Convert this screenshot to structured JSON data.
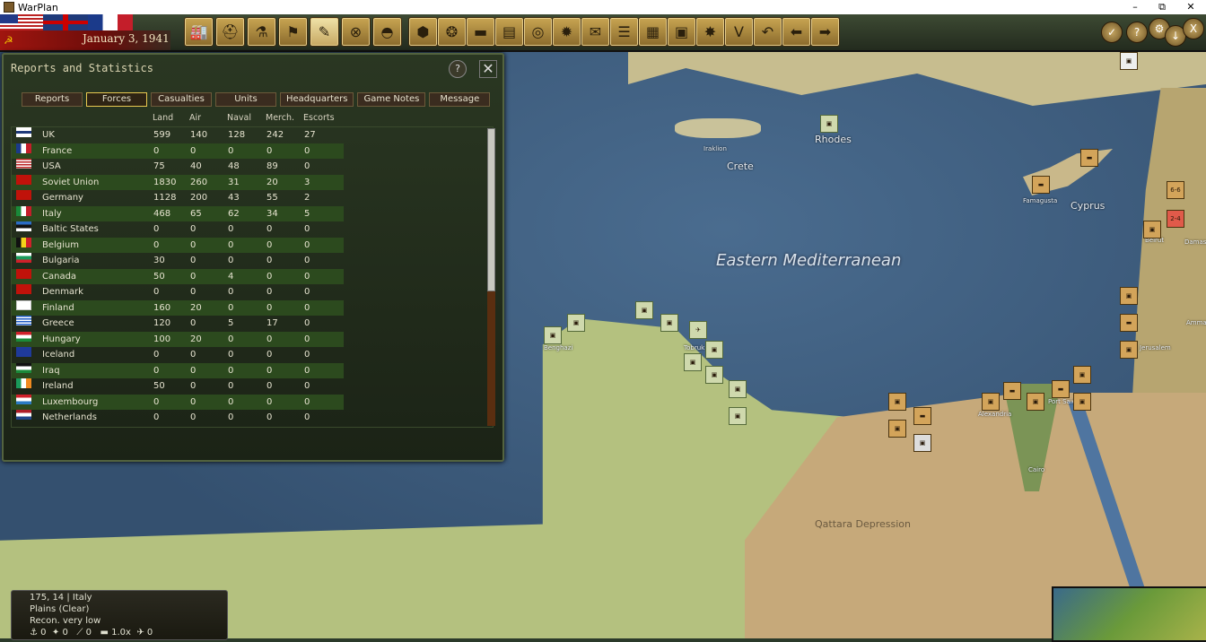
{
  "window": {
    "title": "WarPlan",
    "minimize": "–",
    "maximize": "⧉",
    "close": "✕"
  },
  "toolbar": {
    "date": "January 3, 1941",
    "buttons": [
      "production",
      "research-flask",
      "flag",
      "reports",
      "binoculars",
      "helmet",
      "hex-terrain",
      "hex-cities",
      "tank",
      "supply",
      "target",
      "sun",
      "envelope",
      "rails",
      "grid",
      "border",
      "explosion",
      "victory",
      "undo",
      "prev",
      "next"
    ],
    "right_buttons": [
      "✓",
      "?",
      "↓",
      "X"
    ]
  },
  "panel": {
    "title": "Reports and Statistics",
    "help": "?",
    "close": "✕",
    "tabs": [
      "Reports",
      "Forces",
      "Casualties",
      "Units",
      "Headquarters",
      "Game Notes",
      "Message"
    ],
    "active_tab": "Forces",
    "columns": [
      "Land",
      "Air",
      "Naval",
      "Merch.",
      "Escorts"
    ],
    "rows": [
      {
        "country": "UK",
        "land": "599",
        "air": "140",
        "naval": "128",
        "merch": "242",
        "escorts": "27",
        "flag": "uk"
      },
      {
        "country": "France",
        "land": "0",
        "air": "0",
        "naval": "0",
        "merch": "0",
        "escorts": "0",
        "flag": "fr"
      },
      {
        "country": "USA",
        "land": "75",
        "air": "40",
        "naval": "48",
        "merch": "89",
        "escorts": "0",
        "flag": "us"
      },
      {
        "country": "Soviet Union",
        "land": "1830",
        "air": "260",
        "naval": "31",
        "merch": "20",
        "escorts": "3",
        "flag": "su"
      },
      {
        "country": "Germany",
        "land": "1128",
        "air": "200",
        "naval": "43",
        "merch": "55",
        "escorts": "2",
        "flag": "de"
      },
      {
        "country": "Italy",
        "land": "468",
        "air": "65",
        "naval": "62",
        "merch": "34",
        "escorts": "5",
        "flag": "it"
      },
      {
        "country": "Baltic States",
        "land": "0",
        "air": "0",
        "naval": "0",
        "merch": "0",
        "escorts": "0",
        "flag": "ee"
      },
      {
        "country": "Belgium",
        "land": "0",
        "air": "0",
        "naval": "0",
        "merch": "0",
        "escorts": "0",
        "flag": "be"
      },
      {
        "country": "Bulgaria",
        "land": "30",
        "air": "0",
        "naval": "0",
        "merch": "0",
        "escorts": "0",
        "flag": "bg"
      },
      {
        "country": "Canada",
        "land": "50",
        "air": "0",
        "naval": "4",
        "merch": "0",
        "escorts": "0",
        "flag": "ca"
      },
      {
        "country": "Denmark",
        "land": "0",
        "air": "0",
        "naval": "0",
        "merch": "0",
        "escorts": "0",
        "flag": "dk"
      },
      {
        "country": "Finland",
        "land": "160",
        "air": "20",
        "naval": "0",
        "merch": "0",
        "escorts": "0",
        "flag": "fi"
      },
      {
        "country": "Greece",
        "land": "120",
        "air": "0",
        "naval": "5",
        "merch": "17",
        "escorts": "0",
        "flag": "gr"
      },
      {
        "country": "Hungary",
        "land": "100",
        "air": "20",
        "naval": "0",
        "merch": "0",
        "escorts": "0",
        "flag": "hu"
      },
      {
        "country": "Iceland",
        "land": "0",
        "air": "0",
        "naval": "0",
        "merch": "0",
        "escorts": "0",
        "flag": "is"
      },
      {
        "country": "Iraq",
        "land": "0",
        "air": "0",
        "naval": "0",
        "merch": "0",
        "escorts": "0",
        "flag": "iq"
      },
      {
        "country": "Ireland",
        "land": "50",
        "air": "0",
        "naval": "0",
        "merch": "0",
        "escorts": "0",
        "flag": "ie"
      },
      {
        "country": "Luxembourg",
        "land": "0",
        "air": "0",
        "naval": "0",
        "merch": "0",
        "escorts": "0",
        "flag": "lu"
      },
      {
        "country": "Netherlands",
        "land": "0",
        "air": "0",
        "naval": "0",
        "merch": "0",
        "escorts": "0",
        "flag": "nl"
      }
    ]
  },
  "map": {
    "labels": [
      "Rhodes",
      "Crete",
      "Cyprus",
      "Eastern Mediterranean",
      "Qattara Depression",
      "Iraklion",
      "Alexandria",
      "Cairo",
      "Tobruk",
      "Benghazi",
      "Famagusta",
      "Beirut",
      "Damascus",
      "Jerusalem",
      "Amman",
      "Port Said"
    ]
  },
  "info": {
    "line1": "175, 14 | Italy",
    "line2": "Plains (Clear)",
    "line3": "Recon. very low",
    "stats": [
      "0",
      "0",
      "0",
      "1.0x",
      "0"
    ]
  }
}
